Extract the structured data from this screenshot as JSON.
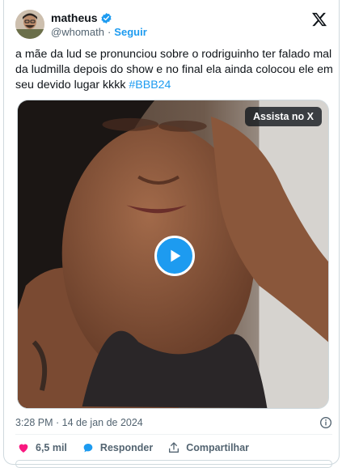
{
  "user": {
    "name": "matheus",
    "handle": "@whomath",
    "separator": "·",
    "follow_label": "Seguir"
  },
  "tweet": {
    "text": "a mãe da lud se pronunciou sobre o rodriguinho ter falado mal da ludmilla depois do show e no final ela ainda colocou ele em seu devido lugar kkkk ",
    "hashtag": "#BBB24"
  },
  "media": {
    "watch_label": "Assista no X"
  },
  "meta": {
    "timestamp": "3:28 PM · 14 de jan de 2024"
  },
  "actions": {
    "likes": "6,5 mil",
    "reply_label": "Responder",
    "share_label": "Compartilhar"
  },
  "colors": {
    "accent": "#1d9bf0",
    "like": "#f91880",
    "text": "#0f1419",
    "muted": "#536471"
  },
  "icons": [
    "verified-badge-icon",
    "x-logo-icon",
    "play-icon",
    "info-icon",
    "heart-icon",
    "reply-bubble-icon",
    "share-icon"
  ]
}
